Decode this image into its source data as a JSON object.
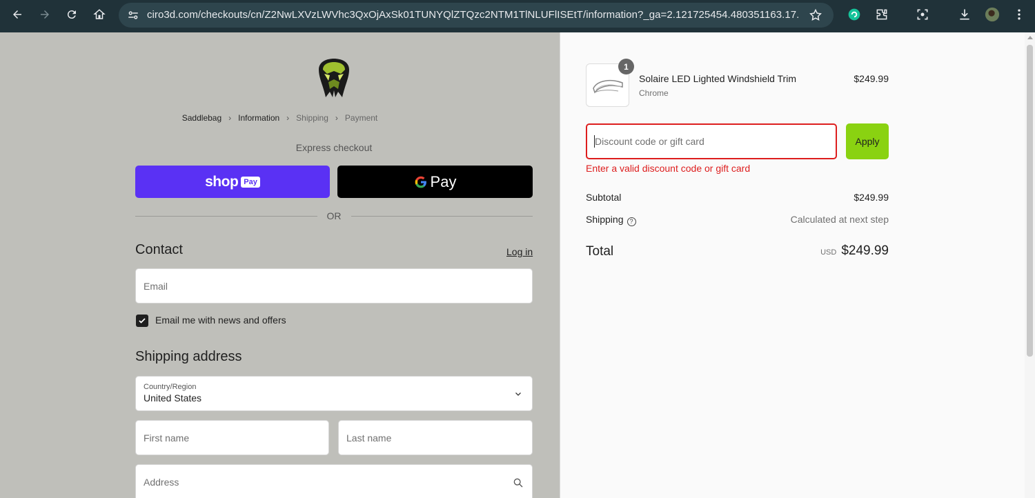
{
  "browser": {
    "url": "ciro3d.com/checkouts/cn/Z2NwLXVzLWVhc3QxOjAxSk01TUNYQlZTQzc2NTM1TlNLUFlISEtT/information?_ga=2.121725454.480351163.17..."
  },
  "breadcrumb": {
    "items": [
      {
        "label": "Saddlebag"
      },
      {
        "label": "Information"
      },
      {
        "label": "Shipping"
      },
      {
        "label": "Payment"
      }
    ]
  },
  "express": {
    "heading": "Express checkout",
    "shoppay_word": "shop",
    "shoppay_badge": "Pay",
    "gpay_word": "Pay",
    "or": "OR"
  },
  "contact": {
    "heading": "Contact",
    "login": "Log in",
    "email_placeholder": "Email",
    "newsletter_label": "Email me with news and offers",
    "newsletter_checked": true
  },
  "shipping": {
    "heading": "Shipping address",
    "country_label": "Country/Region",
    "country_value": "United States",
    "first_name_placeholder": "First name",
    "last_name_placeholder": "Last name",
    "address_placeholder": "Address"
  },
  "order": {
    "item": {
      "quantity": "1",
      "name": "Solaire LED Lighted Windshield Trim",
      "variant": "Chrome",
      "price": "$249.99"
    },
    "discount_placeholder": "Discount code or gift card",
    "apply_label": "Apply",
    "error": "Enter a valid discount code or gift card",
    "subtotal_label": "Subtotal",
    "subtotal_value": "$249.99",
    "shipping_label": "Shipping",
    "shipping_value": "Calculated at next step",
    "total_label": "Total",
    "total_currency": "USD",
    "total_value": "$249.99"
  },
  "colors": {
    "shoppay": "#5a31f4",
    "apply": "#8ad211",
    "error": "#dd1d1d"
  }
}
